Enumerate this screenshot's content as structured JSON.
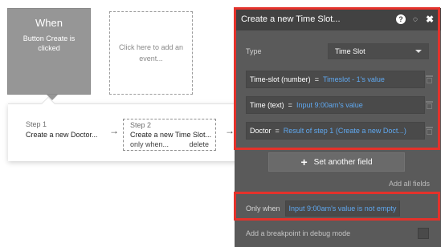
{
  "event": {
    "title": "When",
    "subtitle": "Button Create is clicked"
  },
  "add_event": {
    "label": "Click here to add an event..."
  },
  "steps": [
    {
      "label": "Step 1",
      "name": "Create a new Doctor..."
    },
    {
      "label": "Step 2",
      "name": "Create a new Time Slot...",
      "only_when_label": "only when...",
      "delete_label": "delete"
    }
  ],
  "arrows": {
    "glyph": "→"
  },
  "editor": {
    "title": "Create a new Time Slot...",
    "icons": {
      "help": "?",
      "comment": "◌",
      "close": "✖"
    },
    "type_label": "Type",
    "type_value": "Time Slot",
    "fields": [
      {
        "name": "Time-slot (number)",
        "eq": "=",
        "value": "Timeslot - 1's value"
      },
      {
        "name": "Time (text)",
        "eq": "=",
        "value": "Input 9:00am's value"
      },
      {
        "name": "Doctor",
        "eq": "=",
        "value": "Result of step 1 (Create a new Doct...)"
      }
    ],
    "set_another_field": "Set another field",
    "plus_glyph": "+",
    "add_all_fields": "Add all fields",
    "only_when_label": "Only when",
    "only_when_value": "Input 9:00am's value is not empty",
    "breakpoint_label": "Add a breakpoint in debug mode"
  },
  "colors": {
    "highlight": "#e4322b",
    "panel": "#5a5a5a",
    "panel_header": "#424242",
    "expression": "#5fa8f0",
    "event_block": "#969696"
  }
}
